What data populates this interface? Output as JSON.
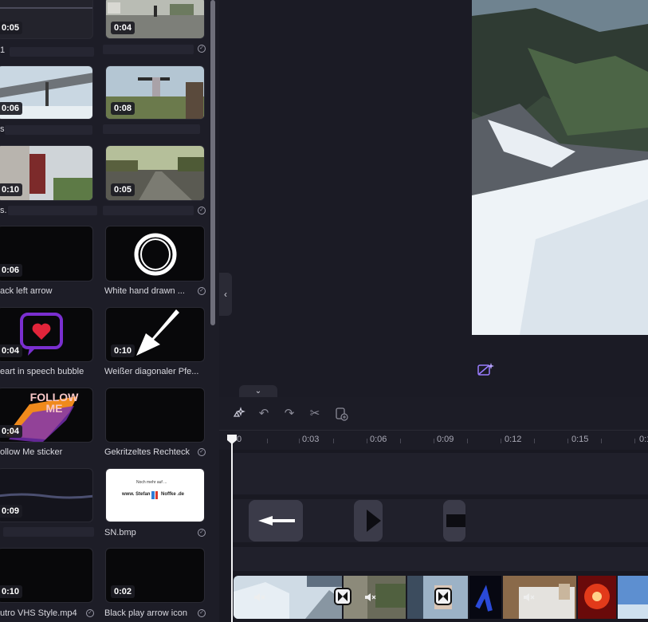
{
  "library": {
    "items": [
      {
        "duration": "0:05",
        "caption": "1"
      },
      {
        "duration": "0:04",
        "caption": ""
      },
      {
        "duration": "0:06",
        "caption": "s"
      },
      {
        "duration": "0:08",
        "caption": ""
      },
      {
        "duration": "0:10",
        "caption": "s."
      },
      {
        "duration": "0:05",
        "caption": ""
      },
      {
        "duration": "0:06",
        "caption": "ack left arrow"
      },
      {
        "duration": "",
        "caption": "White hand drawn ..."
      },
      {
        "duration": "0:04",
        "caption": "eart in speech bubble"
      },
      {
        "duration": "0:10",
        "caption": "Weißer diagonaler Pfe..."
      },
      {
        "duration": "0:04",
        "caption": "ollow Me sticker",
        "thumb_text": "FOLLOW ME"
      },
      {
        "duration": "",
        "caption": "Gekritzeltes Rechteck"
      },
      {
        "duration": "0:09",
        "caption": ""
      },
      {
        "duration": "",
        "caption": "SN.bmp",
        "thumb_lines": [
          "Noch mehr auf ...",
          "www. Stefan",
          "Noffke .de"
        ]
      },
      {
        "duration": "0:10",
        "caption": "utro VHS Style.mp4"
      },
      {
        "duration": "0:02",
        "caption": "Black play arrow icon"
      }
    ]
  },
  "ruler": {
    "labels": [
      "0",
      "0:03",
      "0:06",
      "0:09",
      "0:12",
      "0:15",
      "0:1"
    ]
  },
  "colors": {
    "accent": "#7b5cff",
    "background": "#16161e",
    "panel": "#1d1d27"
  },
  "icons": {
    "toolbar": [
      "magic-wand-icon",
      "undo-icon",
      "redo-icon",
      "scissors-icon",
      "add-clip-icon"
    ],
    "preview": "ai-sparkle-camera-icon"
  }
}
